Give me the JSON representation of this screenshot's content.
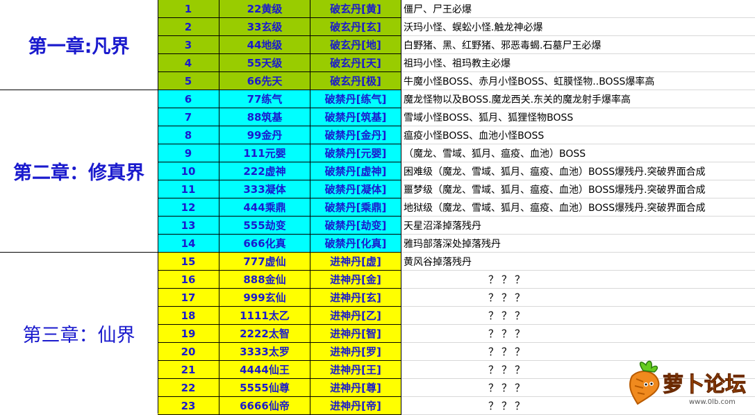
{
  "colors": {
    "chapter1": "#99cc00",
    "chapter2": "#00ffff",
    "chapter3": "#ffff00",
    "level_text": "#1a1acd",
    "chapter_text": "#1a1acd"
  },
  "chapters": [
    {
      "title": "第一章:凡界"
    },
    {
      "title": "第二章：修真界"
    },
    {
      "title": "第三章：仙界"
    }
  ],
  "rows": [
    {
      "num": "1",
      "level": "22黄级",
      "pill": "破玄丹[黄]",
      "desc": "僵尸、尸王必爆",
      "chapter": 1
    },
    {
      "num": "2",
      "level": "33玄级",
      "pill": "破玄丹[玄]",
      "desc": "沃玛小怪、蜈蚣小怪.触龙神必爆",
      "chapter": 1
    },
    {
      "num": "3",
      "level": "44地级",
      "pill": "破玄丹[地]",
      "desc": "白野猪、黑、红野猪、邪恶毒蝎.石墓尸王必爆",
      "chapter": 1
    },
    {
      "num": "4",
      "level": "55天级",
      "pill": "破玄丹[天]",
      "desc": "祖玛小怪、祖玛教主必爆",
      "chapter": 1
    },
    {
      "num": "5",
      "level": "66先天",
      "pill": "破玄丹[极]",
      "desc": "牛魔小怪BOSS、赤月小怪BOSS、虹膜怪物..BOSS爆率高",
      "chapter": 1
    },
    {
      "num": "6",
      "level": "77练气",
      "pill": "破禁丹[练气]",
      "desc": "魔龙怪物以及BOSS.魔龙西关.东关的魔龙射手爆率高",
      "chapter": 2
    },
    {
      "num": "7",
      "level": "88筑基",
      "pill": "破禁丹[筑基]",
      "desc": "雪域小怪BOSS、狐月、狐狸怪物BOSS",
      "chapter": 2
    },
    {
      "num": "8",
      "level": "99金丹",
      "pill": "破禁丹[金丹]",
      "desc": "瘟疫小怪BOSS、血池小怪BOSS",
      "chapter": 2
    },
    {
      "num": "9",
      "level": "111元婴",
      "pill": "破禁丹[元婴]",
      "desc": "（魔龙、雪域、狐月、瘟疫、血池）BOSS",
      "chapter": 2
    },
    {
      "num": "10",
      "level": "222虚神",
      "pill": "破禁丹[虚神]",
      "desc": "困难级（魔龙、雪域、狐月、瘟疫、血池）BOSS爆残丹.突破界面合成",
      "chapter": 2
    },
    {
      "num": "11",
      "level": "333凝体",
      "pill": "破禁丹[凝体]",
      "desc": "噩梦级（魔龙、雪域、狐月、瘟疫、血池）BOSS爆残丹.突破界面合成",
      "chapter": 2
    },
    {
      "num": "12",
      "level": "444乘鼎",
      "pill": "破禁丹[乘鼎]",
      "desc": "地狱级（魔龙、雪域、狐月、瘟疫、血池）BOSS爆残丹.突破界面合成",
      "chapter": 2
    },
    {
      "num": "13",
      "level": "555劫变",
      "pill": "破禁丹[劫变]",
      "desc": "天星沼泽掉落残丹",
      "chapter": 2
    },
    {
      "num": "14",
      "level": "666化真",
      "pill": "破禁丹[化真]",
      "desc": "雅玛部落深处掉落残丹",
      "chapter": 2
    },
    {
      "num": "15",
      "level": "777虚仙",
      "pill": "进神丹[虚]",
      "desc": "黄风谷掉落残丹",
      "chapter": 3
    },
    {
      "num": "16",
      "level": "888金仙",
      "pill": "进神丹[金]",
      "desc": "？？？",
      "chapter": 3
    },
    {
      "num": "17",
      "level": "999玄仙",
      "pill": "进神丹[玄]",
      "desc": "？？？",
      "chapter": 3
    },
    {
      "num": "18",
      "level": "1111太乙",
      "pill": "进神丹[乙]",
      "desc": "？？？",
      "chapter": 3
    },
    {
      "num": "19",
      "level": "2222太智",
      "pill": "进神丹[智]",
      "desc": "？？？",
      "chapter": 3
    },
    {
      "num": "20",
      "level": "3333太罗",
      "pill": "进神丹[罗]",
      "desc": "？？？",
      "chapter": 3
    },
    {
      "num": "21",
      "level": "4444仙王",
      "pill": "进神丹[王]",
      "desc": "？？？",
      "chapter": 3
    },
    {
      "num": "22",
      "level": "5555仙尊",
      "pill": "进神丹[尊]",
      "desc": "？？？",
      "chapter": 3
    },
    {
      "num": "23",
      "level": "6666仙帝",
      "pill": "进神丹[帝]",
      "desc": "？？？",
      "chapter": 3
    }
  ],
  "watermark": {
    "text": "萝卜论坛",
    "url_text": "www.0lb.com",
    "icon": "carrot-icon"
  }
}
